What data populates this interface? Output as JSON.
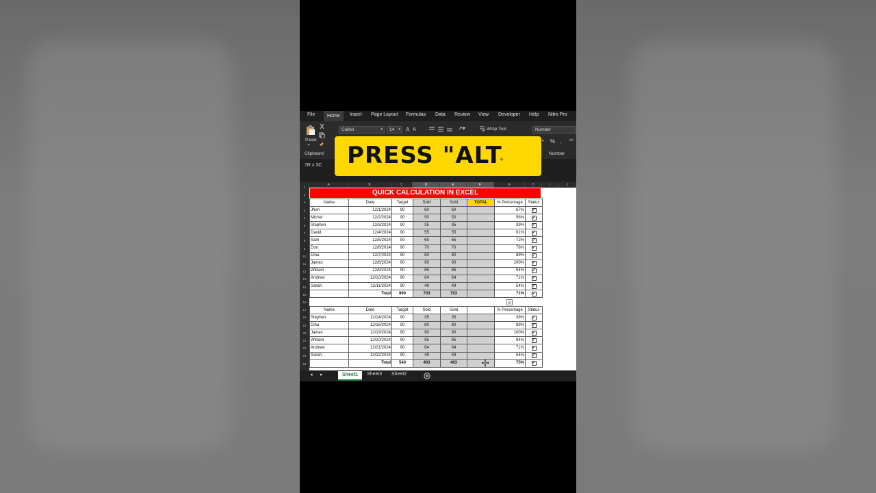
{
  "menu": [
    "File",
    "Home",
    "Insert",
    "Page Layout",
    "Formulas",
    "Data",
    "Review",
    "View",
    "Developer",
    "Help",
    "Nitro Pro"
  ],
  "ribbon": {
    "paste": "Paste",
    "clipboard": "Clipboard",
    "font_name": "Calibri",
    "font_size": "14",
    "wrap_text": "Wrap Text",
    "number_format": "Number",
    "number_group": "Number",
    "percent": "%"
  },
  "name_box": "7R x 3C",
  "banner": {
    "text": "PRESS \"ALT",
    "plus": "+"
  },
  "columns": [
    "A",
    "B",
    "C",
    "D",
    "E",
    "F",
    "G",
    "H",
    "I",
    "J"
  ],
  "title": "QUICK CALCULATION IN EXCEL",
  "table1": {
    "headers": [
      "Name",
      "Date",
      "Target",
      "Sold",
      "Sold",
      "TOTAL",
      "% Percentage",
      "Status"
    ],
    "rows": [
      [
        "Jhon",
        "12/1/2024",
        "90",
        "60",
        "60",
        "",
        "67%"
      ],
      [
        "Michel",
        "12/2/2024",
        "90",
        "50",
        "50",
        "",
        "56%"
      ],
      [
        "Stephen",
        "12/3/2024",
        "90",
        "35",
        "35",
        "",
        "39%"
      ],
      [
        "David",
        "12/4/2024",
        "90",
        "55",
        "55",
        "",
        "61%"
      ],
      [
        "Sam",
        "12/5/2024",
        "90",
        "65",
        "65",
        "",
        "72%"
      ],
      [
        "Don",
        "12/6/2024",
        "90",
        "70",
        "70",
        "",
        "78%"
      ],
      [
        "Dina",
        "12/7/2024",
        "90",
        "80",
        "80",
        "",
        "89%"
      ],
      [
        "James",
        "12/8/2024",
        "90",
        "90",
        "90",
        "",
        "100%"
      ],
      [
        "William",
        "12/9/2024",
        "90",
        "85",
        "85",
        "",
        "94%"
      ],
      [
        "Andrew",
        "12/10/2024",
        "90",
        "64",
        "64",
        "",
        "71%"
      ],
      [
        "Sarah",
        "12/11/2024",
        "90",
        "49",
        "49",
        "",
        "54%"
      ]
    ],
    "total": [
      "Total",
      "990",
      "703",
      "703",
      "",
      "71%"
    ]
  },
  "table2": {
    "headers": [
      "Name",
      "Date",
      "Target",
      "Sold",
      "Sold",
      "",
      "% Percentage",
      "Status"
    ],
    "rows": [
      [
        "Stephen",
        "12/14/2024",
        "90",
        "35",
        "35",
        "",
        "39%"
      ],
      [
        "Dina",
        "12/18/2024",
        "90",
        "80",
        "80",
        "",
        "89%"
      ],
      [
        "James",
        "12/19/2024",
        "90",
        "90",
        "90",
        "",
        "100%"
      ],
      [
        "William",
        "12/20/2024",
        "90",
        "85",
        "85",
        "",
        "94%"
      ],
      [
        "Andrew",
        "12/21/2024",
        "90",
        "64",
        "64",
        "",
        "71%"
      ],
      [
        "Sarah",
        "12/22/2024",
        "90",
        "49",
        "49",
        "",
        "54%"
      ]
    ],
    "total": [
      "Total",
      "540",
      "403",
      "403",
      "",
      "75%"
    ]
  },
  "checkbox": "✔",
  "sheets": [
    "Sheet1",
    "Sheet3",
    "Sheet2"
  ]
}
